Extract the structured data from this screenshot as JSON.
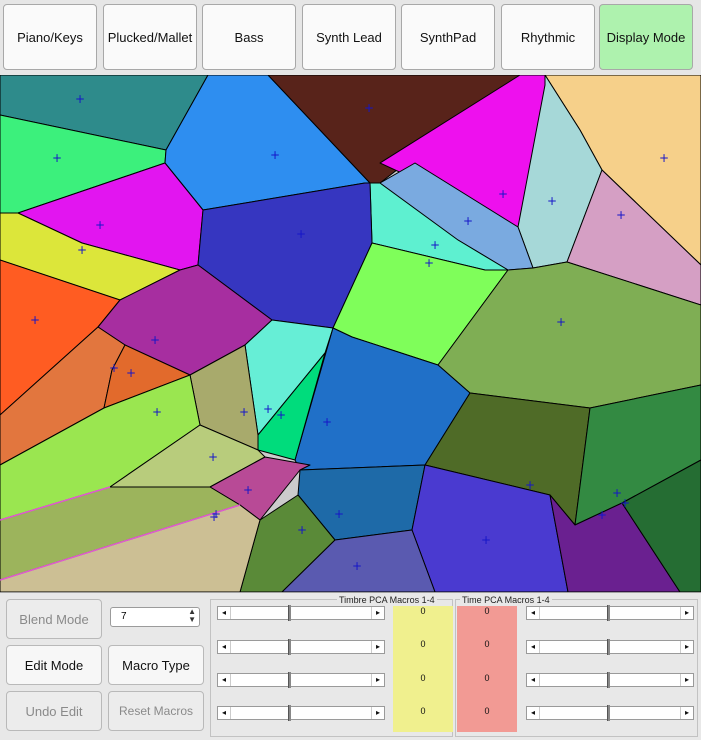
{
  "top_buttons": [
    {
      "label": "Piano/Keys"
    },
    {
      "label": "Plucked/Mallet"
    },
    {
      "label": "Bass"
    },
    {
      "label": "Synth Lead"
    },
    {
      "label": "SynthPad"
    },
    {
      "label": "Rhythmic"
    },
    {
      "label": "Display Mode"
    }
  ],
  "left_controls": {
    "blend_mode": "Blend Mode",
    "edit_mode": "Edit Mode",
    "undo_edit": "Undo Edit",
    "macro_type": "Macro Type",
    "reset_macros": "Reset Macros",
    "spinner_value": "7"
  },
  "timbre": {
    "title": "Timbre PCA Macros 1-4",
    "values": [
      "0",
      "0",
      "0",
      "0"
    ],
    "slider_levels": [
      0.41,
      0.41,
      0.41,
      0.41
    ],
    "color": "#f0f08e"
  },
  "time": {
    "title": "Time PCA Macros 1-4",
    "values": [
      "0",
      "0",
      "0",
      "0"
    ],
    "slider_levels": [
      0.48,
      0.48,
      0.48,
      0.48
    ],
    "color": "#f29a94"
  },
  "marker_color": "#1515c8",
  "active_color": "#aef2ae"
}
